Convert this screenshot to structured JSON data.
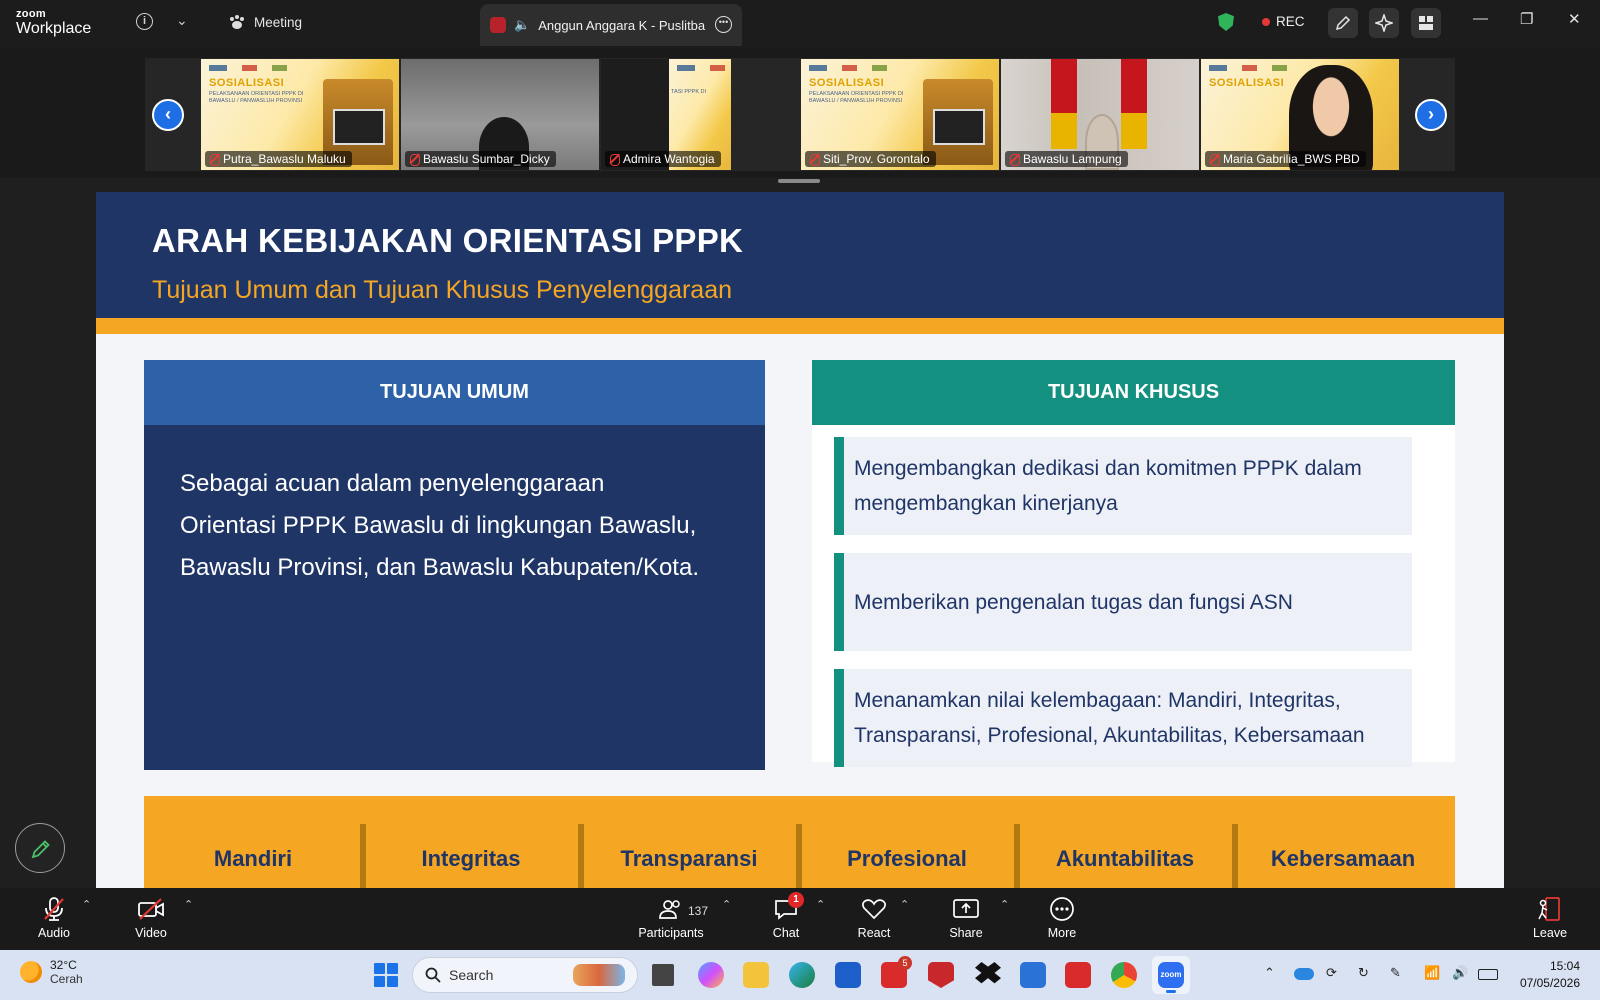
{
  "app": {
    "logo_line1": "zoom",
    "logo_line2": "Workplace",
    "meeting_label": "Meeting",
    "active_tab_title": "Anggun Anggara K - Puslitba",
    "rec_label": "REC"
  },
  "gallery": {
    "prev_icon": "chevron-left-icon",
    "next_icon": "chevron-right-icon",
    "tiles": [
      {
        "name": "Putra_Bawaslu Maluku",
        "kind": "poster"
      },
      {
        "name": "Bawaslu Sumbar_Dicky",
        "kind": "cam-room"
      },
      {
        "name": "Admira Wantogia",
        "kind": "cam-dark"
      },
      {
        "name": "Siti_Prov. Gorontalo",
        "kind": "poster"
      },
      {
        "name": "Bawaslu Lampung",
        "kind": "cam-flag"
      },
      {
        "name": "Maria Gabrilia_BWS PBD",
        "kind": "poster-face"
      }
    ],
    "poster_title": "SOSIALISASI",
    "poster_subtitle": "PELAKSANAAN ORIENTASI PPPK DI BAWASLU / PANWASLUH PROVINSI",
    "poster_subtitle_cut": "TASI PPPK DI"
  },
  "slide": {
    "title": "ARAH KEBIJAKAN ORIENTASI PPPK",
    "subtitle": "Tujuan Umum dan Tujuan Khusus Penyelenggaraan",
    "umum": {
      "heading": "TUJUAN UMUM",
      "body": "Sebagai acuan dalam penyelenggaraan Orientasi PPPK Bawaslu di lingkungan Bawaslu, Bawaslu Provinsi, dan Bawaslu Kabupaten/Kota."
    },
    "khusus": {
      "heading": "TUJUAN KHUSUS",
      "items": [
        "Mengembangkan dedikasi dan komitmen PPPK dalam mengembangkan kinerjanya",
        "Memberikan pengenalan tugas dan fungsi ASN",
        "Menanamkan nilai kelembagaan: Mandiri, Integritas, Transparansi, Profesional, Akuntabilitas, Kebersamaan"
      ]
    },
    "values": [
      "Mandiri",
      "Integritas",
      "Transparansi",
      "Profesional",
      "Akuntabilitas",
      "Kebersamaan"
    ]
  },
  "controls": {
    "audio": "Audio",
    "video": "Video",
    "participants": "Participants",
    "participant_count": "137",
    "chat": "Chat",
    "chat_badge": "1",
    "react": "React",
    "share": "Share",
    "more": "More",
    "leave": "Leave"
  },
  "taskbar": {
    "temperature": "32°C",
    "weather": "Cerah",
    "search_placeholder": "Search",
    "badge_count": "5",
    "time": "15:04",
    "date": "07/05/2026"
  },
  "colors": {
    "slide_navy": "#1f3566",
    "slide_orange": "#f5a623",
    "umum_blue": "#2e62a8",
    "khusus_teal": "#139080",
    "zoom_blue": "#1e6fe6",
    "rec_red": "#e53935"
  }
}
